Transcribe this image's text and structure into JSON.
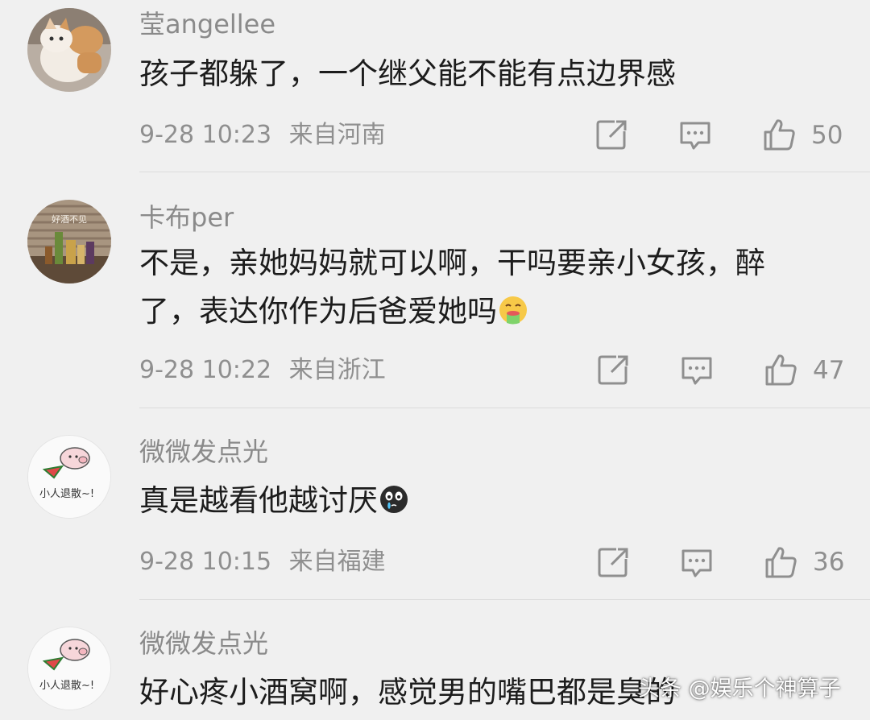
{
  "comments": [
    {
      "username": "莹angellee",
      "text": "孩子都躲了，一个继父能不能有点边界感",
      "time": "9-28 10:23",
      "location": "来自河南",
      "likes": "50",
      "avatar": "cat-avatar"
    },
    {
      "username": "卡布per",
      "text": "不是，亲她妈妈就可以啊，干吗要亲小女孩，醉了，表达你作为后爸爱她吗",
      "emoji": "vomiting-face-emoji",
      "time": "9-28 10:22",
      "location": "来自浙江",
      "likes": "47",
      "avatar": "bottles-avatar",
      "avatar_sign": "好酒不见"
    },
    {
      "username": "微微发点光",
      "text": "真是越看他越讨厌",
      "emoji": "crying-face-emoji",
      "time": "9-28 10:15",
      "location": "来自福建",
      "likes": "36",
      "avatar": "pig-sticker-avatar",
      "avatar_sign": "小人退散~!"
    },
    {
      "username": "微微发点光",
      "text": "好心疼小酒窝啊，感觉男的嘴巴都是臭的",
      "avatar": "pig-sticker-avatar",
      "avatar_sign": "小人退散~!"
    }
  ],
  "watermark": "头条 @娱乐个神算子",
  "colors": {
    "background": "#f0f0f0",
    "text": "#1c1c1c",
    "meta": "#8f8f8f",
    "username": "#8a8a8a"
  }
}
